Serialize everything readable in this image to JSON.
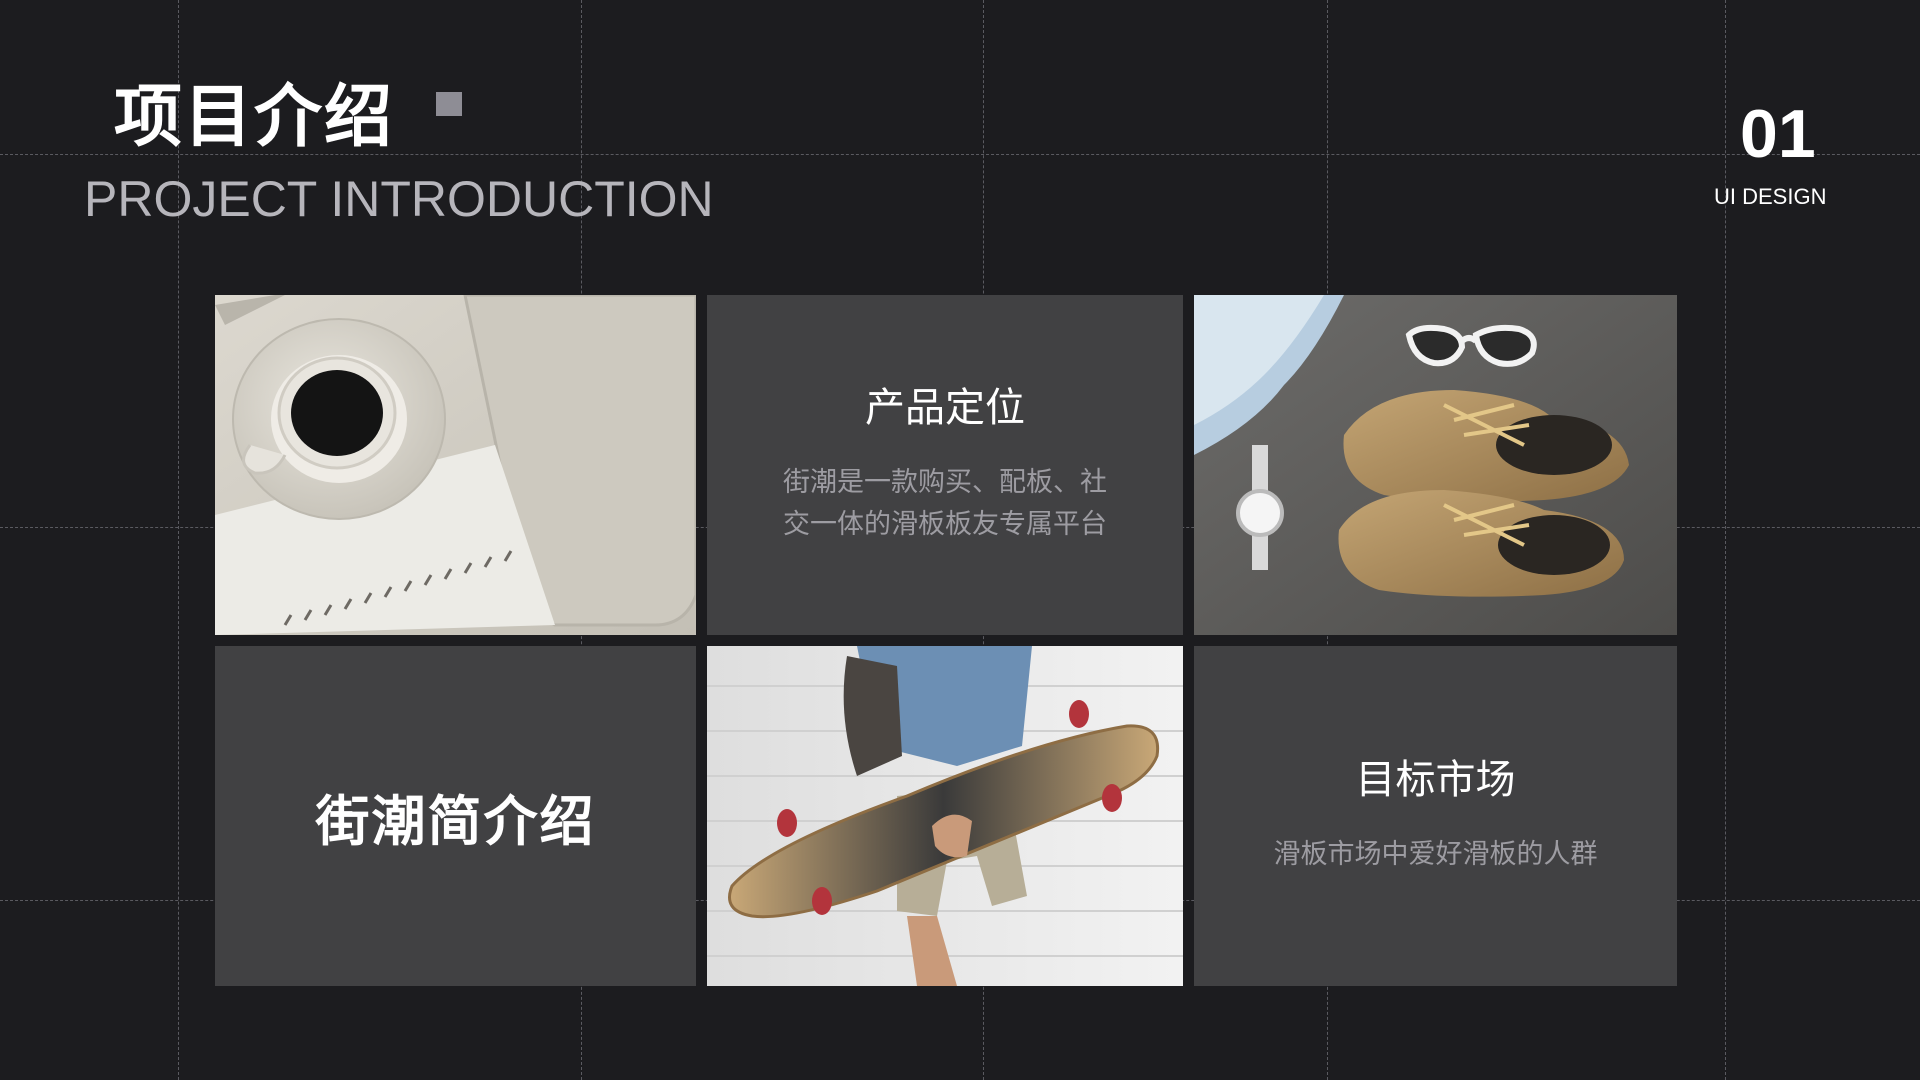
{
  "header": {
    "title_cn": "项目介绍",
    "title_en": "PROJECT INTRODUCTION",
    "page_number": "01",
    "page_subtitle": "UI DESIGN"
  },
  "tiles": {
    "positioning": {
      "heading": "产品定位",
      "line1": "街潮是一款购买、配板、社",
      "line2": "交一体的滑板板友专属平台"
    },
    "brand": {
      "title": "街潮简介绍"
    },
    "market": {
      "heading": "目标市场",
      "body": "滑板市场中爱好滑板的人群"
    }
  },
  "images": {
    "coffee": "coffee-notebook-photo",
    "shoes": "boots-sunglasses-watch-photo",
    "skater": "skateboard-person-photo"
  },
  "colors": {
    "background": "#1c1c1f",
    "tile": "#414143",
    "accent_square": "#8e8d95",
    "secondary_text": "#9d9ca2"
  }
}
